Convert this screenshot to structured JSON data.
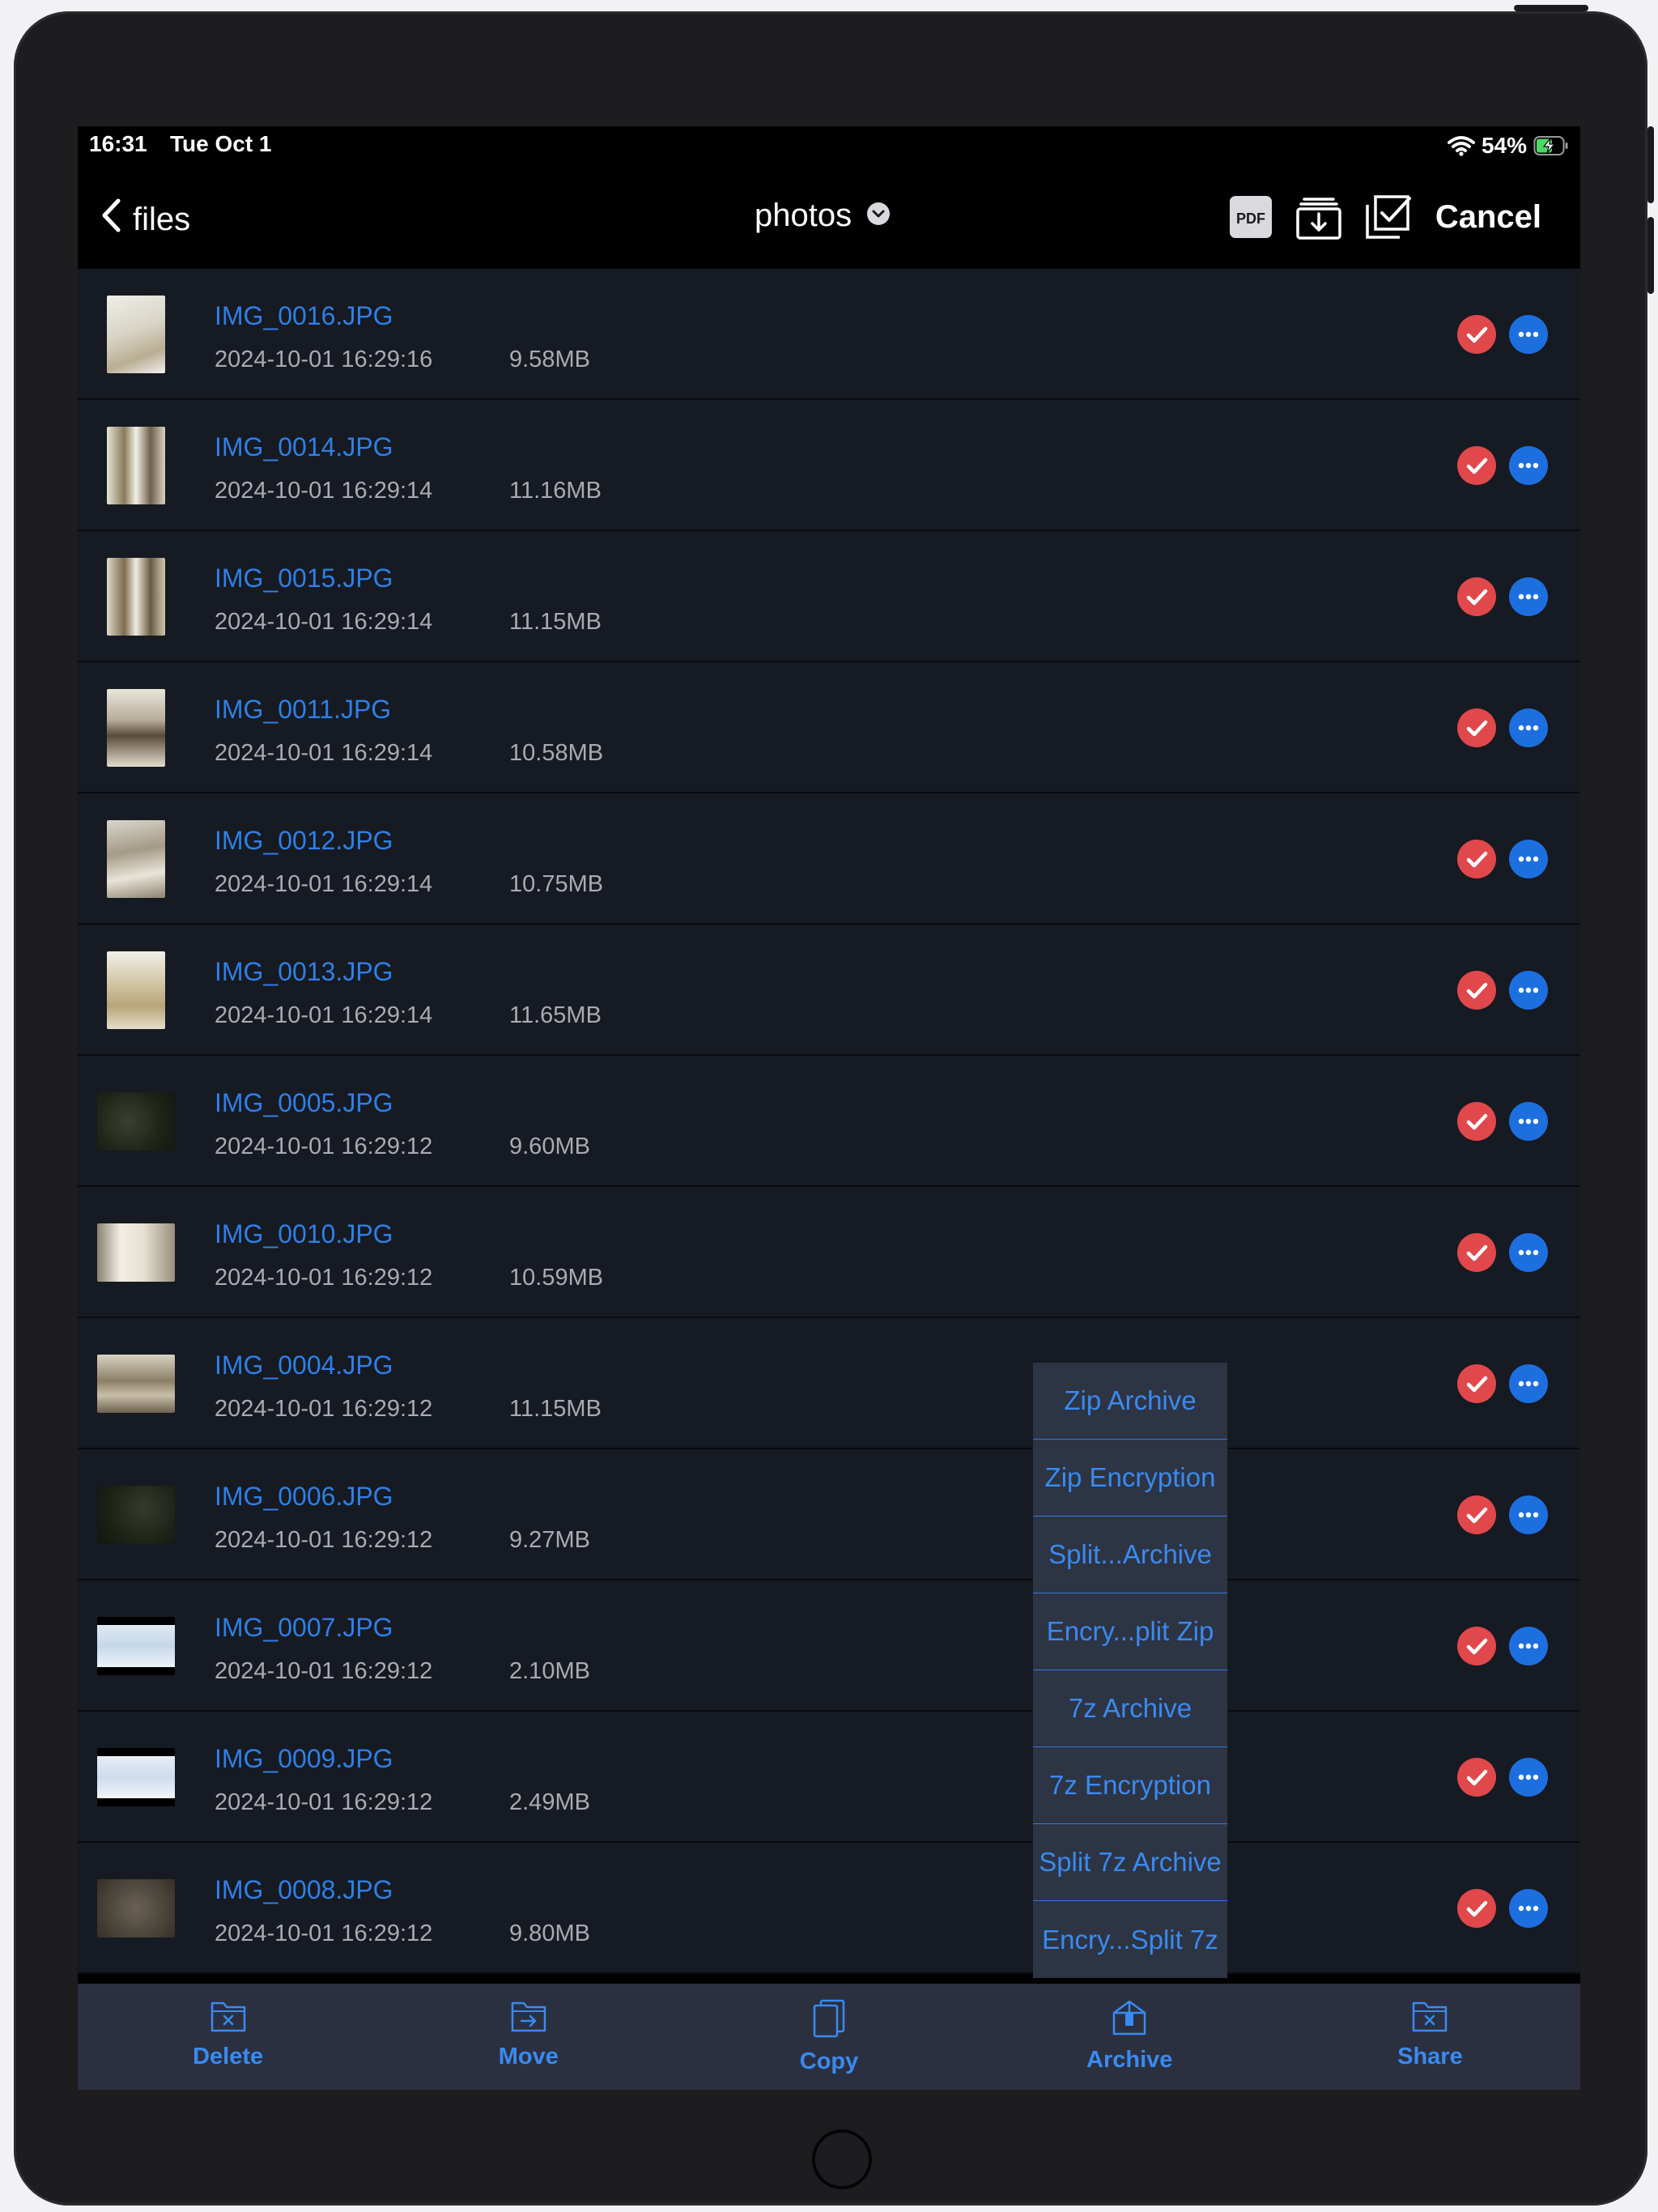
{
  "status_bar": {
    "time": "16:31",
    "date": "Tue Oct 1",
    "battery_percent": "54%",
    "icons": [
      "wifi-icon",
      "battery-charging-icon"
    ]
  },
  "nav": {
    "back_label": "files",
    "title": "photos",
    "cancel_label": "Cancel",
    "icons": [
      "chevron-left-icon",
      "chevron-down-circle-icon",
      "pdf-icon",
      "download-tray-icon",
      "select-all-icon"
    ]
  },
  "files": [
    {
      "name": "IMG_0016.JPG",
      "date": "2024-10-01 16:29:16",
      "size": "9.58MB",
      "selected": true
    },
    {
      "name": "IMG_0014.JPG",
      "date": "2024-10-01 16:29:14",
      "size": "11.16MB",
      "selected": true
    },
    {
      "name": "IMG_0015.JPG",
      "date": "2024-10-01 16:29:14",
      "size": "11.15MB",
      "selected": true
    },
    {
      "name": "IMG_0011.JPG",
      "date": "2024-10-01 16:29:14",
      "size": "10.58MB",
      "selected": true
    },
    {
      "name": "IMG_0012.JPG",
      "date": "2024-10-01 16:29:14",
      "size": "10.75MB",
      "selected": true
    },
    {
      "name": "IMG_0013.JPG",
      "date": "2024-10-01 16:29:14",
      "size": "11.65MB",
      "selected": true
    },
    {
      "name": "IMG_0005.JPG",
      "date": "2024-10-01 16:29:12",
      "size": "9.60MB",
      "selected": true
    },
    {
      "name": "IMG_0010.JPG",
      "date": "2024-10-01 16:29:12",
      "size": "10.59MB",
      "selected": true
    },
    {
      "name": "IMG_0004.JPG",
      "date": "2024-10-01 16:29:12",
      "size": "11.15MB",
      "selected": true
    },
    {
      "name": "IMG_0006.JPG",
      "date": "2024-10-01 16:29:12",
      "size": "9.27MB",
      "selected": true
    },
    {
      "name": "IMG_0007.JPG",
      "date": "2024-10-01 16:29:12",
      "size": "2.10MB",
      "selected": true
    },
    {
      "name": "IMG_0009.JPG",
      "date": "2024-10-01 16:29:12",
      "size": "2.49MB",
      "selected": true
    },
    {
      "name": "IMG_0008.JPG",
      "date": "2024-10-01 16:29:12",
      "size": "9.80MB",
      "selected": true
    }
  ],
  "archive_menu": {
    "items": [
      "Zip Archive",
      "Zip Encryption",
      "Split...Archive",
      "Encry...plit Zip",
      "7z Archive",
      "7z Encryption",
      "Split 7z Archive",
      "Encry...Split 7z"
    ]
  },
  "toolbar": {
    "items": [
      {
        "label": "Delete",
        "icon": "folder-x-icon"
      },
      {
        "label": "Move",
        "icon": "folder-arrow-icon"
      },
      {
        "label": "Copy",
        "icon": "copy-icon"
      },
      {
        "label": "Archive",
        "icon": "archive-box-icon"
      },
      {
        "label": "Share",
        "icon": "folder-x-icon"
      }
    ]
  },
  "colors": {
    "accent": "#2f7fe6",
    "selected_check": "#e0484b",
    "more_button": "#1d6fe0",
    "row_background": "#161a22",
    "toolbar_background": "#2b3040"
  }
}
